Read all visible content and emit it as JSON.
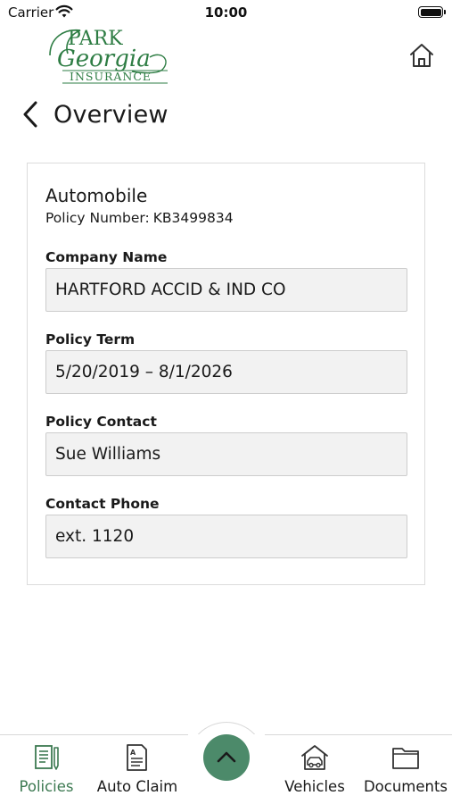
{
  "status_bar": {
    "carrier": "Carrier",
    "time": "10:00",
    "icons": [
      "wifi-icon",
      "battery-icon"
    ]
  },
  "header": {
    "logo": {
      "line1": "PARK",
      "line2": "Georgia",
      "line3": "INSURANCE",
      "color": "#2e7d44"
    },
    "home_icon": "home-icon",
    "back_icon": "chevron-left-icon",
    "title": "Overview"
  },
  "card": {
    "title": "Automobile",
    "policy_number_label": "Policy Number:",
    "policy_number_value": "KB3499834",
    "fields": [
      {
        "label": "Company Name",
        "value": "HARTFORD ACCID & IND CO"
      },
      {
        "label": "Policy Term",
        "value": "5/20/2019 – 8/1/2026"
      },
      {
        "label": "Policy Contact",
        "value": "Sue Williams"
      },
      {
        "label": "Contact Phone",
        "value": "ext. 1120"
      }
    ]
  },
  "tab_bar": {
    "tabs": [
      {
        "label": "Policies",
        "icon": "policies-icon",
        "active": true
      },
      {
        "label": "Auto Claim",
        "icon": "auto-claim-icon",
        "active": false
      },
      {
        "label": "Vehicles",
        "icon": "vehicles-icon",
        "active": false
      },
      {
        "label": "Documents",
        "icon": "documents-icon",
        "active": false
      }
    ],
    "center_button_icon": "chevron-up-icon"
  },
  "colors": {
    "brand_green": "#4c8a6a",
    "active_tab": "#3d7a52",
    "field_background": "#f2f2f2"
  }
}
